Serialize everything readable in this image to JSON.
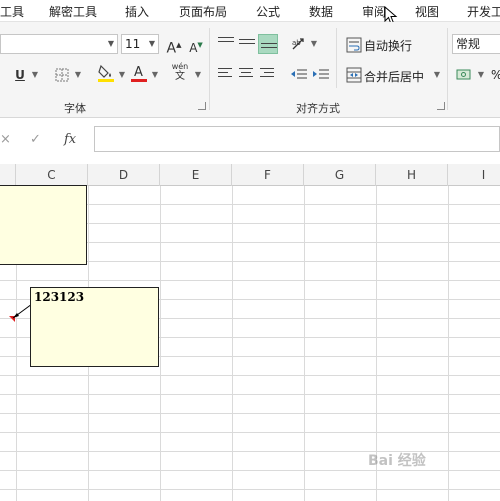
{
  "menu": {
    "items": [
      "工具",
      "解密工具",
      "插入",
      "页面布局",
      "公式",
      "数据",
      "审阅",
      "视图",
      "开发工"
    ]
  },
  "ribbon": {
    "font_name": "",
    "font_size": "11",
    "number_format": "常规",
    "wrap_text_label": "自动换行",
    "merge_center_label": "合并后居中",
    "font_group_label": "字体",
    "alignment_group_label": "对齐方式",
    "phonetic_label": "wén",
    "percent_label": "%"
  },
  "formula_bar": {
    "cancel_symbol": "×",
    "enter_symbol": "✓",
    "fx_label": "fx",
    "value": ""
  },
  "grid": {
    "columns": [
      "C",
      "D",
      "E",
      "F",
      "G",
      "H",
      "I"
    ],
    "comments": [
      {
        "text": ""
      },
      {
        "text": "123123"
      }
    ]
  },
  "watermark": "Bai 经验",
  "colors": {
    "font_color_bar": "#e02020",
    "fill_color_bar": "#ffe000",
    "comment_fill": "#ffffe1",
    "selected_button": "#a9d9c0"
  }
}
